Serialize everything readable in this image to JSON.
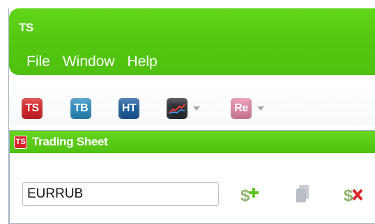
{
  "app": {
    "logo_text": "TS"
  },
  "menu": {
    "items": [
      "File",
      "Window",
      "Help"
    ]
  },
  "toolbar": {
    "buttons": [
      {
        "label": "TS",
        "color": "#d8262a",
        "icon": "ts-icon"
      },
      {
        "label": "TB",
        "color": "#2f8fc1",
        "icon": "tb-icon"
      },
      {
        "label": "HT",
        "color": "#1f5f9e",
        "icon": "ht-icon"
      },
      {
        "label": "",
        "color": "#2b2f33",
        "icon": "chart-icon"
      },
      {
        "label": "Re",
        "color": "#e58aa8",
        "icon": "re-icon"
      }
    ]
  },
  "trading_sheet": {
    "icon_text": "TS",
    "title": "Trading Sheet",
    "symbol_value": "EURRUB"
  },
  "colors": {
    "green": "#55c912",
    "red": "#d8262a"
  }
}
